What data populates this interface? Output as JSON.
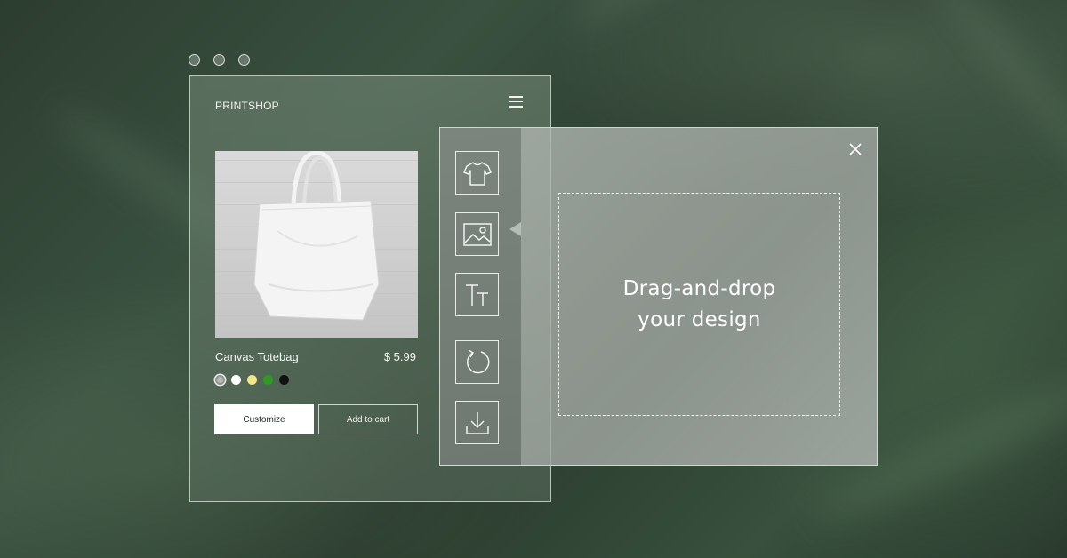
{
  "shop": {
    "brand": "PRINTSHOP",
    "product": {
      "name": "Canvas Totebag",
      "price": "$ 5.99",
      "colors": [
        "#b8b8b8",
        "#ffffff",
        "#f2e58a",
        "#2f9a24",
        "#111111"
      ],
      "selected_color_index": 0
    },
    "buttons": {
      "customize": "Customize",
      "add_to_cart": "Add to cart"
    }
  },
  "editor": {
    "tools": [
      "tshirt-icon",
      "image-icon",
      "text-size-icon",
      "rotate-icon",
      "download-icon"
    ],
    "dropzone_line1": "Drag-and-drop",
    "dropzone_line2": "your design"
  }
}
